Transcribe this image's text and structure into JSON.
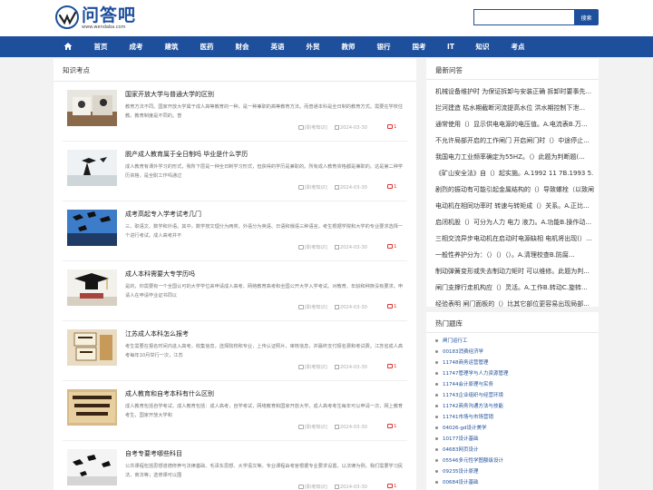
{
  "header": {
    "logo_text": "问答吧",
    "logo_domain": "www.wendaba.com",
    "search_placeholder": "",
    "search_button": "搜索"
  },
  "nav": {
    "home_icon": "home-icon",
    "items": [
      "首页",
      "成考",
      "建筑",
      "医药",
      "财会",
      "英语",
      "外贸",
      "教师",
      "银行",
      "国考",
      "IT",
      "知识",
      "考点"
    ]
  },
  "main": {
    "title": "知识考点",
    "articles": [
      {
        "title": "国家开放大学与普通大学的区别",
        "desc": "教育方法不同。国家开放大学属于成人高等教育的一种，是一种兼职的高等教育方法。而普通本科是全日制的教育方式。需要在学校住教。教育制度是不同的。普",
        "category": "[职考知识]",
        "date": "2024-03-30",
        "comments": "1"
      },
      {
        "title": "脱产成人教育属于全日制吗 毕业是什么学历",
        "desc": "成人教育有课外学习的形式，我所下层是一种全日制学习形式，但获得的学历是兼职的。所有成人教育资格都是兼职的。这是第二种学历资格，是全职工作吗通过",
        "category": "[职考知识]",
        "date": "2024-03-30",
        "comments": "1"
      },
      {
        "title": "成考高起专入学考试考几门",
        "desc": "三、职语文、数学和外语。其中，数学按文理分为两类，外语分为英语、日语和俄语三种语言。考生根据学院和大学的专业要求选择一个进行考试。成人高考并不",
        "category": "[职考知识]",
        "date": "2024-03-30",
        "comments": "1"
      },
      {
        "title": "成人本科需要大专学历吗",
        "desc": "是的，你需要有一个全国认可的大学学位来申请成人高考、网络教育高考和全国公开大学入学考试。对教育、年龄和种族没有要求。申请人在申请毕业证书同以",
        "category": "[职考知识]",
        "date": "2024-03-30",
        "comments": "1"
      },
      {
        "title": "江苏成人本科怎么报考",
        "desc": "考生需要在报名时间内进入高考，收集信息，选择院校和专业，上传认证照片，审核信息，并最终支付报名费和考试费。江苏省成人高考每年10月举行一次，江苏",
        "category": "[职考知识]",
        "date": "2024-03-30",
        "comments": "1"
      },
      {
        "title": "成人教育和自考本科有什么区别",
        "desc": "成人教育包括自学考试，成人教育包括：成人高考，自学考试，网络教育和国家开放大学。成人高考考生每年可以申请一次，网上教育考生，国家开放大学和",
        "category": "[职考知识]",
        "date": "2024-03-30",
        "comments": "1"
      },
      {
        "title": "自考专要考哪些科目",
        "desc": "公共课程包括思想道德修养与法律基础、毛泽东思想、大学语文等。专业课程由考官根据专业要求设置。以法律为例，我们需要学习民法、商法等；选修课可以围",
        "category": "[职考知识]",
        "date": "2024-03-30",
        "comments": "1"
      }
    ]
  },
  "sidebar": {
    "qa_title": "最新问答",
    "qa_items": [
      "机械设备维护时 为保证拆卸与安装正确 拆卸时要事先...",
      "拦河建造 枯水期截断河流提高水位 洪水期控制下泄...",
      "通常使用（）显示供电电源的电压值。A.电流表B.万...",
      "不允许局部开启的工作闸门 开启闸门时（）中途停止...",
      "我国电力工业频率确定为55HZ。（）此题为判断题(...",
      "《矿山安全法》自（）起实施。A.1992 11 7B.1993 5...",
      "剧烈的振动有可能引起金属结构的（）导致螺栓（以致闸...",
      "电动机在相同功率时 转速与转矩成（）关系。A.正比...",
      "启闭机股（）可分为人力 电力 液力。A.功能B.操作动...",
      "三相交流异步电动机在启动时电源缺相 电机将出现(）...",
      "一般性养护分为：（）（）（）。A.清理校查B.防腐...",
      "制动弹簧变形或失去制动力矩时 可以维修。此题为判...",
      "闸门支撑行走机构应（）灵活。A.工作B.转动C.旋转...",
      "经验表明 闸门面板的（）比其它部位更容易出现局部..."
    ],
    "topics_title": "热门题库",
    "topics": [
      "闸门运行工",
      "00183消费经济学",
      "11748商务运营管理",
      "11747管理学与人力资源管理",
      "11744会计原理与实务",
      "11743企业组织与经营环境",
      "11742商务沟通方法与技能",
      "11741市场与市场营销",
      "04026-gd设计美学",
      "10177设计基础",
      "04683网页设计",
      "05546多元性学图额级设计",
      "09235设计原理",
      "00684设计基础"
    ]
  }
}
